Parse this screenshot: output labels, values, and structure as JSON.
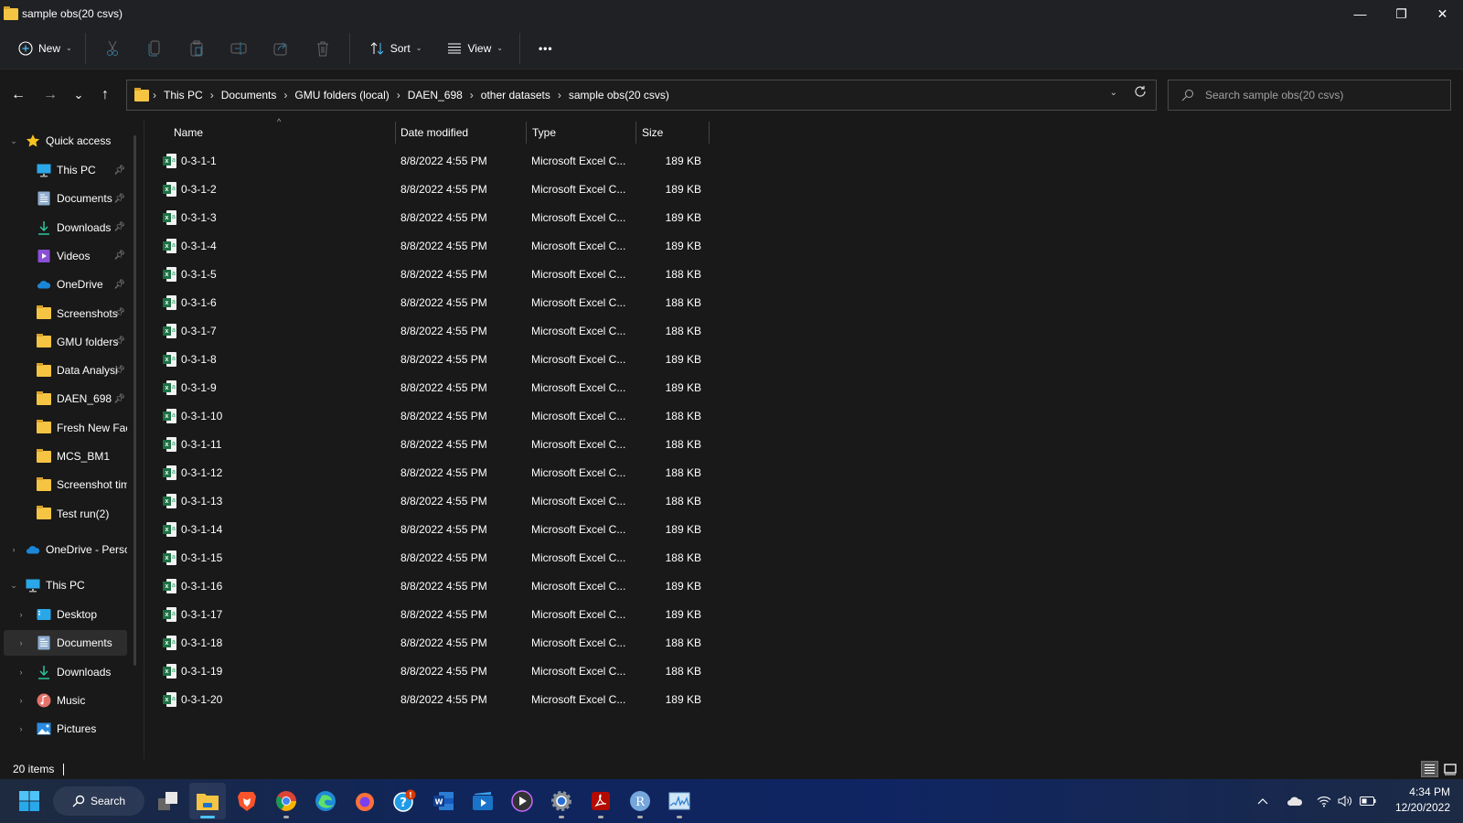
{
  "window": {
    "title": "sample obs(20 csvs)",
    "controls": {
      "minimize": "—",
      "restore": "❐",
      "close": "✕"
    }
  },
  "toolbar": {
    "new_label": "New",
    "sort_label": "Sort",
    "view_label": "View",
    "more_label": "•••",
    "icons": [
      "cut-icon",
      "copy-icon",
      "paste-icon",
      "rename-icon",
      "share-icon",
      "delete-icon"
    ]
  },
  "nav": {
    "back": "←",
    "forward": "→",
    "recent": "⌄",
    "up": "↑",
    "breadcrumb": [
      "This PC",
      "Documents",
      "GMU folders (local)",
      "DAEN_698",
      "other datasets",
      "sample obs(20 csvs)"
    ],
    "search_placeholder": "Search sample obs(20 csvs)"
  },
  "sidebar": {
    "quick_access": {
      "label": "Quick access",
      "items": [
        {
          "label": "This PC",
          "icon": "monitor-icon",
          "pinned": true
        },
        {
          "label": "Documents",
          "icon": "documents-icon",
          "pinned": true
        },
        {
          "label": "Downloads",
          "icon": "download-icon",
          "pinned": true
        },
        {
          "label": "Videos",
          "icon": "videos-icon",
          "pinned": true
        },
        {
          "label": "OneDrive",
          "icon": "cloud-icon",
          "pinned": true
        },
        {
          "label": "Screenshots",
          "icon": "folder-icon",
          "pinned": true
        },
        {
          "label": "GMU folders",
          "icon": "folder-icon",
          "pinned": true
        },
        {
          "label": "Data Analysi",
          "icon": "folder-icon",
          "pinned": true
        },
        {
          "label": "DAEN_698",
          "icon": "folder-icon",
          "pinned": true
        },
        {
          "label": "Fresh New Face",
          "icon": "folder-icon",
          "pinned": false
        },
        {
          "label": "MCS_BM1",
          "icon": "folder-icon",
          "pinned": false
        },
        {
          "label": "Screenshot tim",
          "icon": "folder-icon",
          "pinned": false
        },
        {
          "label": "Test run(2)",
          "icon": "folder-icon",
          "pinned": false
        }
      ]
    },
    "onedrive_label": "OneDrive - Perso",
    "this_pc": {
      "label": "This PC",
      "items": [
        {
          "label": "Desktop",
          "icon": "desktop-icon"
        },
        {
          "label": "Documents",
          "icon": "documents-icon",
          "selected": true
        },
        {
          "label": "Downloads",
          "icon": "download-icon"
        },
        {
          "label": "Music",
          "icon": "music-icon"
        },
        {
          "label": "Pictures",
          "icon": "pictures-icon"
        }
      ]
    }
  },
  "columns": {
    "name": "Name",
    "date": "Date modified",
    "type": "Type",
    "size": "Size"
  },
  "files": [
    {
      "name": "0-3-1-1",
      "date": "8/8/2022 4:55 PM",
      "type": "Microsoft Excel C...",
      "size": "189 KB"
    },
    {
      "name": "0-3-1-2",
      "date": "8/8/2022 4:55 PM",
      "type": "Microsoft Excel C...",
      "size": "189 KB"
    },
    {
      "name": "0-3-1-3",
      "date": "8/8/2022 4:55 PM",
      "type": "Microsoft Excel C...",
      "size": "189 KB"
    },
    {
      "name": "0-3-1-4",
      "date": "8/8/2022 4:55 PM",
      "type": "Microsoft Excel C...",
      "size": "189 KB"
    },
    {
      "name": "0-3-1-5",
      "date": "8/8/2022 4:55 PM",
      "type": "Microsoft Excel C...",
      "size": "188 KB"
    },
    {
      "name": "0-3-1-6",
      "date": "8/8/2022 4:55 PM",
      "type": "Microsoft Excel C...",
      "size": "188 KB"
    },
    {
      "name": "0-3-1-7",
      "date": "8/8/2022 4:55 PM",
      "type": "Microsoft Excel C...",
      "size": "188 KB"
    },
    {
      "name": "0-3-1-8",
      "date": "8/8/2022 4:55 PM",
      "type": "Microsoft Excel C...",
      "size": "189 KB"
    },
    {
      "name": "0-3-1-9",
      "date": "8/8/2022 4:55 PM",
      "type": "Microsoft Excel C...",
      "size": "189 KB"
    },
    {
      "name": "0-3-1-10",
      "date": "8/8/2022 4:55 PM",
      "type": "Microsoft Excel C...",
      "size": "188 KB"
    },
    {
      "name": "0-3-1-11",
      "date": "8/8/2022 4:55 PM",
      "type": "Microsoft Excel C...",
      "size": "188 KB"
    },
    {
      "name": "0-3-1-12",
      "date": "8/8/2022 4:55 PM",
      "type": "Microsoft Excel C...",
      "size": "188 KB"
    },
    {
      "name": "0-3-1-13",
      "date": "8/8/2022 4:55 PM",
      "type": "Microsoft Excel C...",
      "size": "188 KB"
    },
    {
      "name": "0-3-1-14",
      "date": "8/8/2022 4:55 PM",
      "type": "Microsoft Excel C...",
      "size": "189 KB"
    },
    {
      "name": "0-3-1-15",
      "date": "8/8/2022 4:55 PM",
      "type": "Microsoft Excel C...",
      "size": "188 KB"
    },
    {
      "name": "0-3-1-16",
      "date": "8/8/2022 4:55 PM",
      "type": "Microsoft Excel C...",
      "size": "189 KB"
    },
    {
      "name": "0-3-1-17",
      "date": "8/8/2022 4:55 PM",
      "type": "Microsoft Excel C...",
      "size": "189 KB"
    },
    {
      "name": "0-3-1-18",
      "date": "8/8/2022 4:55 PM",
      "type": "Microsoft Excel C...",
      "size": "188 KB"
    },
    {
      "name": "0-3-1-19",
      "date": "8/8/2022 4:55 PM",
      "type": "Microsoft Excel C...",
      "size": "188 KB"
    },
    {
      "name": "0-3-1-20",
      "date": "8/8/2022 4:55 PM",
      "type": "Microsoft Excel C...",
      "size": "189 KB"
    }
  ],
  "status": {
    "item_count": "20 items"
  },
  "taskbar": {
    "search_label": "Search",
    "apps": [
      "task-view",
      "file-explorer",
      "brave",
      "chrome",
      "edge",
      "firefox",
      "get-help",
      "word",
      "video-editor",
      "media-player",
      "settings",
      "acrobat",
      "r",
      "resource-monitor"
    ],
    "clock_time": "4:34 PM",
    "clock_date": "12/20/2022"
  },
  "colors": {
    "accent": "#4cc2ff",
    "folder": "#f6c443",
    "excel": "#1d7044"
  }
}
